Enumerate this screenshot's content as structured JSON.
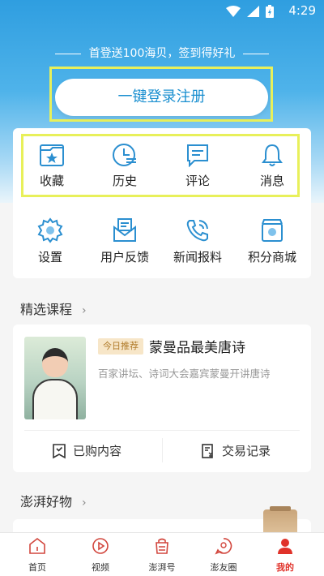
{
  "status_bar": {
    "time": "4:29",
    "icons": [
      "wifi-icon",
      "signal-icon",
      "battery-charging-icon"
    ]
  },
  "promo_text": "首登送100海贝，签到得好礼",
  "login_button": "一键登录注册",
  "quick_actions": [
    {
      "icon": "bookmark-star-icon",
      "label": "收藏"
    },
    {
      "icon": "clock-history-icon",
      "label": "历史"
    },
    {
      "icon": "comment-icon",
      "label": "评论"
    },
    {
      "icon": "bell-icon",
      "label": "消息"
    }
  ],
  "tools": [
    {
      "icon": "settings-icon",
      "label": "设置"
    },
    {
      "icon": "feedback-mail-icon",
      "label": "用户反馈"
    },
    {
      "icon": "phone-report-icon",
      "label": "新闻报料"
    },
    {
      "icon": "points-mall-icon",
      "label": "积分商城"
    }
  ],
  "featured_courses": {
    "title": "精选课程",
    "course": {
      "tag": "今日推荐",
      "title": "蒙曼品最美唐诗",
      "description": "百家讲坛、诗词大会嘉宾蒙曼开讲唐诗"
    },
    "purchased": "已购内容",
    "transactions": "交易记录"
  },
  "shop": {
    "title": "澎湃好物"
  },
  "tabs": [
    {
      "icon": "home-icon",
      "label": "首页",
      "active": false
    },
    {
      "icon": "video-icon",
      "label": "视频",
      "active": false
    },
    {
      "icon": "pengpai-account-icon",
      "label": "澎湃号",
      "active": false
    },
    {
      "icon": "friends-circle-icon",
      "label": "澎友圈",
      "active": false
    },
    {
      "icon": "profile-icon",
      "label": "我的",
      "active": true
    }
  ],
  "colors": {
    "accent": "#1a8fd0",
    "tab_active": "#e0322a",
    "highlight_frame": "#e8f05a"
  }
}
